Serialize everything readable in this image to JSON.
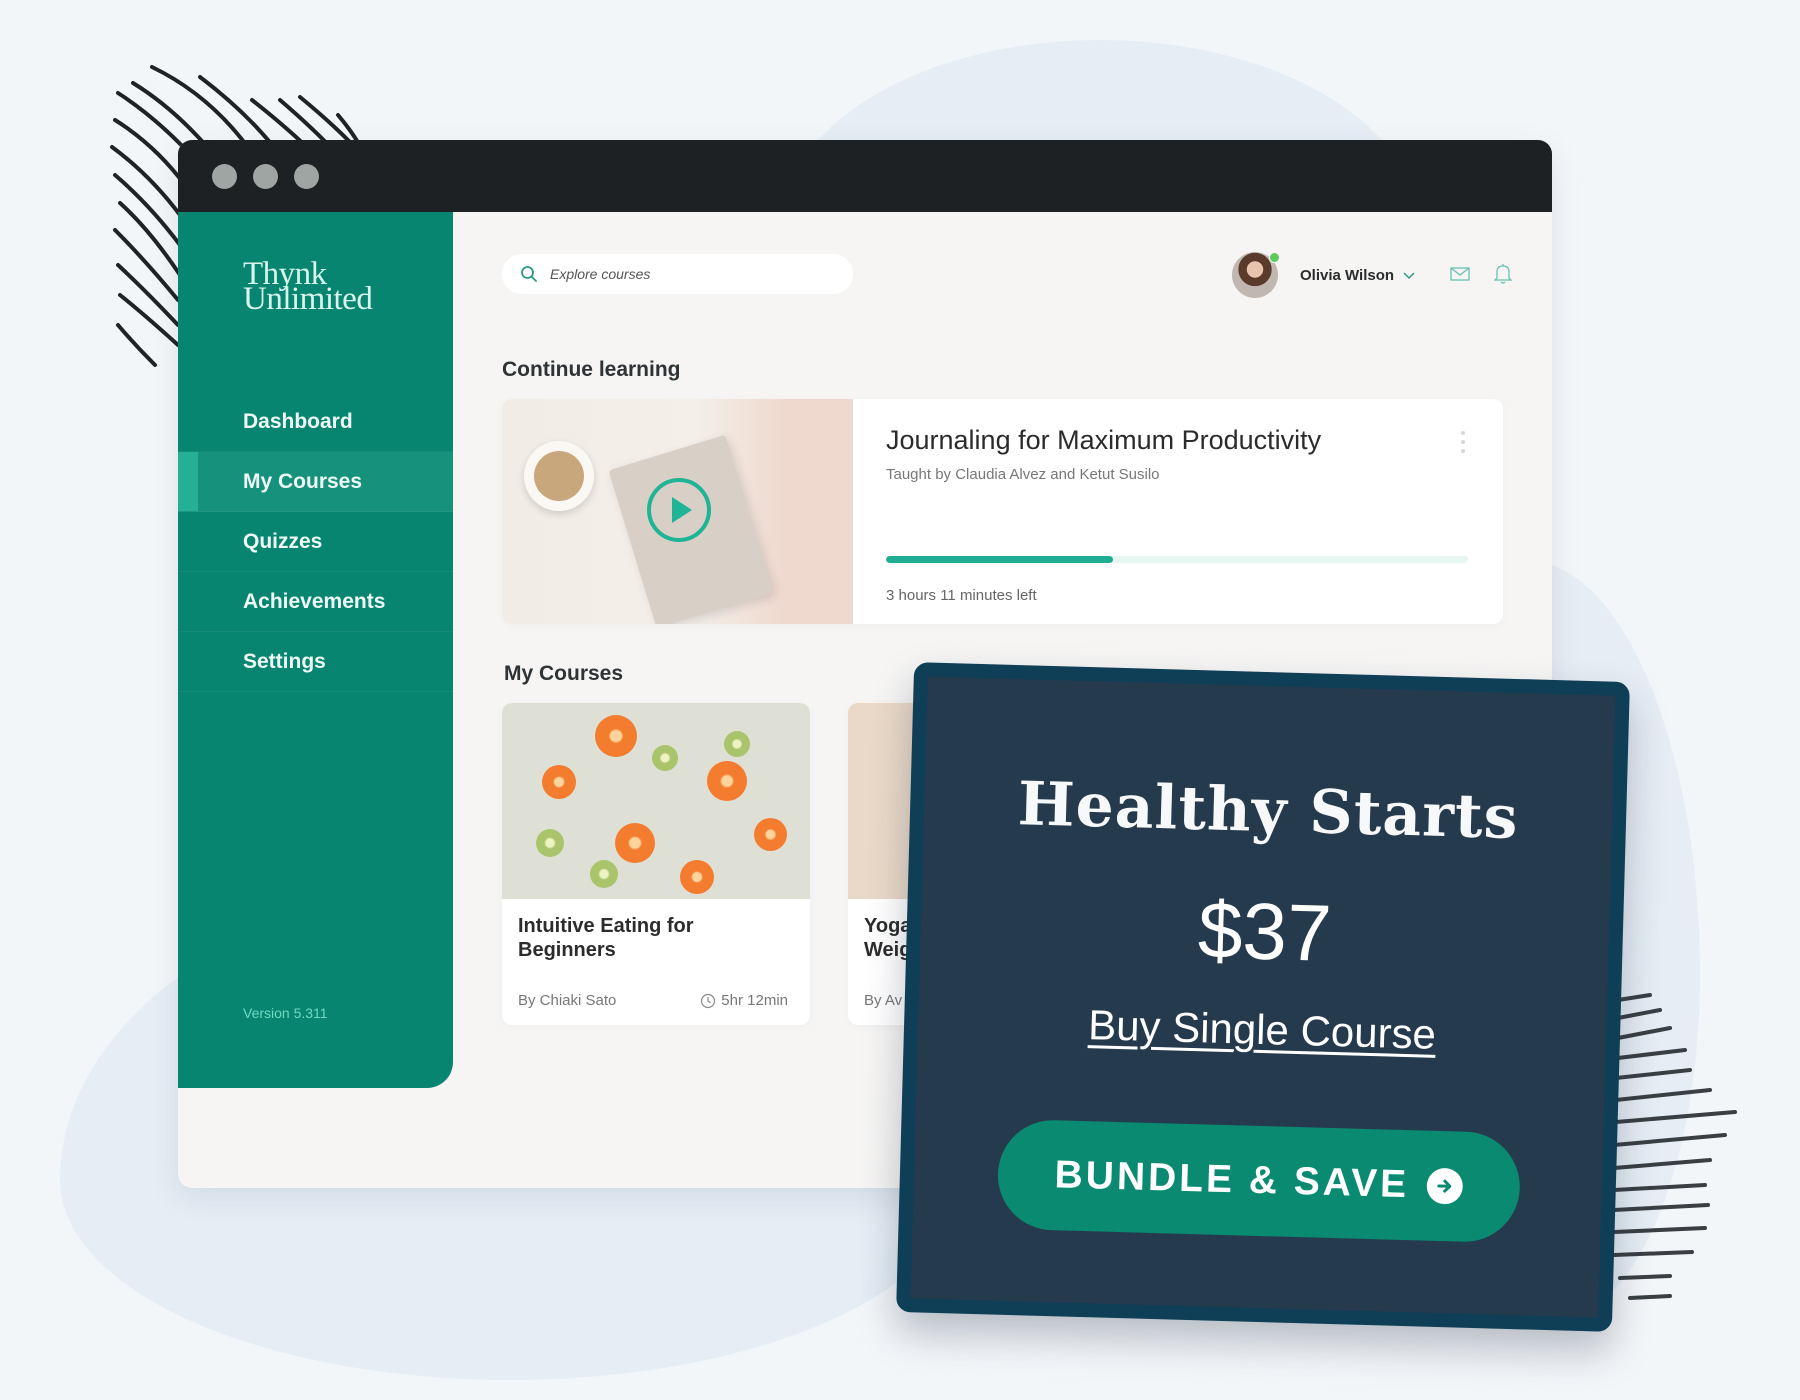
{
  "window": {
    "controls": [
      "close",
      "minimize",
      "maximize"
    ]
  },
  "brand": {
    "line1": "Thynk",
    "line2": "Unlimited"
  },
  "sidebar": {
    "items": [
      {
        "label": "Dashboard",
        "active": false
      },
      {
        "label": "My Courses",
        "active": true
      },
      {
        "label": "Quizzes",
        "active": false
      },
      {
        "label": "Achievements",
        "active": false
      },
      {
        "label": "Settings",
        "active": false
      }
    ],
    "version": "Version 5.311"
  },
  "header": {
    "search_placeholder": "Explore courses",
    "user_name": "Olivia Wilson",
    "user_online": true,
    "icons": [
      "search-icon",
      "chevron-down-icon",
      "mail-icon",
      "bell-icon"
    ]
  },
  "continue_learning": {
    "heading": "Continue learning",
    "course": {
      "title": "Journaling for Maximum Productivity",
      "subtitle": "Taught by Claudia Alvez and Ketut Susilo",
      "progress_percent": 39,
      "time_left": "3 hours 11 minutes left"
    }
  },
  "my_courses": {
    "heading": "My Courses",
    "courses": [
      {
        "title": "Intuitive Eating for Beginners",
        "author": "By Chiaki Sato",
        "duration": "5hr 12min"
      },
      {
        "title": "Yoga Weig",
        "author": "By Av",
        "duration": ""
      }
    ]
  },
  "promo": {
    "title": "Healthy Starts",
    "price": "$37",
    "link_label": "Buy Single Course",
    "button_label": "BUNDLE & SAVE"
  },
  "colors": {
    "brand_green": "#088570",
    "accent_teal": "#20ae93",
    "titlebar": "#1d2124",
    "promo_bg": "#263a4e",
    "promo_border": "#0f3e57"
  }
}
